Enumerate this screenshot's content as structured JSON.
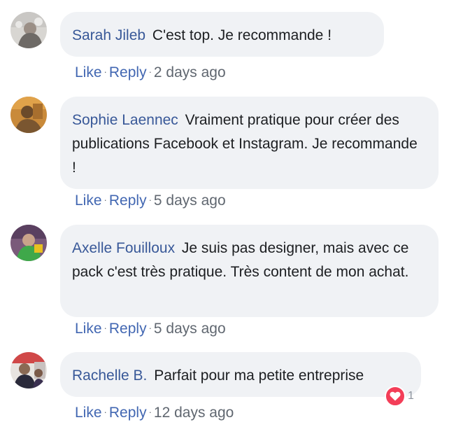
{
  "comments": [
    {
      "author": "Sarah Jileb",
      "text": "C'est top. Je recommande !",
      "like": "Like",
      "reply": "Reply",
      "dot": "·",
      "time": "2 days ago"
    },
    {
      "author": "Sophie Laennec",
      "text": "Vraiment pratique pour créer des publications Facebook et Instagram. Je recommande !",
      "like": "Like",
      "reply": "Reply",
      "dot": "·",
      "time": "5 days ago"
    },
    {
      "author": "Axelle Fouilloux",
      "text": "Je suis pas designer, mais avec ce pack c'est très pratique. Très content de mon achat.",
      "like": "Like",
      "reply": "Reply",
      "dot": "·",
      "time": "5 days ago"
    },
    {
      "author": "Rachelle B.",
      "text": "Parfait pour ma petite entreprise",
      "like": "Like",
      "reply": "Reply",
      "dot": "·",
      "time": "12 days ago",
      "reaction": {
        "icon": "heart-icon",
        "count": "1",
        "color": "#f33e58"
      }
    }
  ],
  "colors": {
    "author": "#385898",
    "link": "#4267b2",
    "bubble": "#f0f2f5",
    "meta": "#606770"
  }
}
